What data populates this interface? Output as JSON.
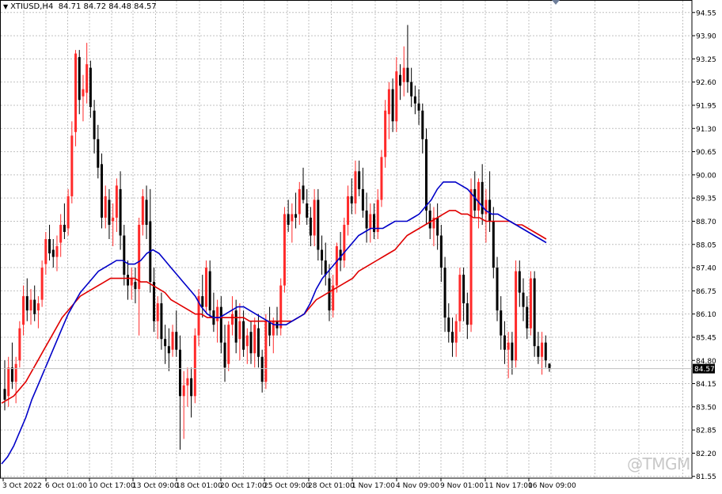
{
  "window": {
    "symbol_label": "XTIUSD,H4",
    "ohlc_label": "84.71 84.72 84.48 84.57",
    "watermark": "@TMGM"
  },
  "colors": {
    "bull": "#ff2a2a",
    "bear": "#000000",
    "ma_fast": "#0000c8",
    "ma_slow": "#e00000",
    "grid": "#c0c0c0",
    "price_line": "#c0c0c0"
  },
  "chart_data": {
    "type": "candlestick",
    "symbol": "XTIUSD",
    "timeframe": "H4",
    "ylim": [
      81.5,
      94.9
    ],
    "y_ticks": [
      "94.55",
      "93.90",
      "93.25",
      "92.60",
      "91.95",
      "91.30",
      "90.65",
      "90.00",
      "89.35",
      "88.70",
      "88.05",
      "87.40",
      "86.75",
      "86.10",
      "85.45",
      "84.80",
      "84.15",
      "83.50",
      "82.85",
      "82.20",
      "81.55"
    ],
    "x_ticks": [
      "3 Oct 2022",
      "6 Oct 01:00",
      "10 Oct 17:00",
      "13 Oct 09:00",
      "18 Oct 01:00",
      "20 Oct 17:00",
      "25 Oct 09:00",
      "28 Oct 01:00",
      "1 Nov 17:00",
      "4 Nov 09:00",
      "9 Nov 01:00",
      "11 Nov 17:00",
      "16 Nov 09:00"
    ],
    "current_price": "84.57",
    "ohlc": [
      [
        84.0,
        84.8,
        83.4,
        83.7
      ],
      [
        83.8,
        84.9,
        83.5,
        84.6
      ],
      [
        84.6,
        85.3,
        84.0,
        84.2
      ],
      [
        84.2,
        84.9,
        83.6,
        84.7
      ],
      [
        84.8,
        85.9,
        84.6,
        85.7
      ],
      [
        85.8,
        86.9,
        85.5,
        86.6
      ],
      [
        86.6,
        87.1,
        85.9,
        86.2
      ],
      [
        86.2,
        86.8,
        85.8,
        86.5
      ],
      [
        86.5,
        86.9,
        85.9,
        86.1
      ],
      [
        86.2,
        86.6,
        85.7,
        86.4
      ],
      [
        86.5,
        87.6,
        86.3,
        87.4
      ],
      [
        87.5,
        88.4,
        87.2,
        88.2
      ],
      [
        88.2,
        88.6,
        87.6,
        87.8
      ],
      [
        87.9,
        88.2,
        87.4,
        87.7
      ],
      [
        87.7,
        88.3,
        87.3,
        88.0
      ],
      [
        88.1,
        88.9,
        87.7,
        88.6
      ],
      [
        88.6,
        89.2,
        88.2,
        88.4
      ],
      [
        88.5,
        89.6,
        88.3,
        89.4
      ],
      [
        89.4,
        91.5,
        89.2,
        91.1
      ],
      [
        91.2,
        93.5,
        90.8,
        93.4
      ],
      [
        93.3,
        93.5,
        91.7,
        92.1
      ],
      [
        92.2,
        92.8,
        91.5,
        92.4
      ],
      [
        92.3,
        93.7,
        92.0,
        93.1
      ],
      [
        93.0,
        93.2,
        91.6,
        91.9
      ],
      [
        91.8,
        92.1,
        90.6,
        91.0
      ],
      [
        91.0,
        91.4,
        89.9,
        90.2
      ],
      [
        90.3,
        90.6,
        88.5,
        88.8
      ],
      [
        88.8,
        89.7,
        88.5,
        89.4
      ],
      [
        89.3,
        89.6,
        88.2,
        88.6
      ],
      [
        88.7,
        89.2,
        88.0,
        88.8
      ],
      [
        88.8,
        89.9,
        88.4,
        89.7
      ],
      [
        89.6,
        90.1,
        87.9,
        88.3
      ],
      [
        88.3,
        88.6,
        86.9,
        87.2
      ],
      [
        87.2,
        87.6,
        86.5,
        86.9
      ],
      [
        86.9,
        87.4,
        86.5,
        87.1
      ],
      [
        87.0,
        87.4,
        86.4,
        86.8
      ],
      [
        86.8,
        88.8,
        85.5,
        88.6
      ],
      [
        88.6,
        89.6,
        88.3,
        89.4
      ],
      [
        89.3,
        89.7,
        88.2,
        88.6
      ],
      [
        88.7,
        89.6,
        86.7,
        87.0
      ],
      [
        87.0,
        87.4,
        85.6,
        85.9
      ],
      [
        85.9,
        86.6,
        85.4,
        86.4
      ],
      [
        86.4,
        86.7,
        85.1,
        85.4
      ],
      [
        85.4,
        85.8,
        84.7,
        85.2
      ],
      [
        85.2,
        85.7,
        84.5,
        85.0
      ],
      [
        85.1,
        85.8,
        84.9,
        85.6
      ],
      [
        85.6,
        86.2,
        84.9,
        85.1
      ],
      [
        85.1,
        85.5,
        82.3,
        83.8
      ],
      [
        83.8,
        84.5,
        82.6,
        84.1
      ],
      [
        84.1,
        84.6,
        83.5,
        84.3
      ],
      [
        84.3,
        84.6,
        83.2,
        83.8
      ],
      [
        83.8,
        85.7,
        83.6,
        85.5
      ],
      [
        85.5,
        86.8,
        85.2,
        86.6
      ],
      [
        86.6,
        87.2,
        86.0,
        86.3
      ],
      [
        86.3,
        87.6,
        86.1,
        87.4
      ],
      [
        87.3,
        87.6,
        86.0,
        86.2
      ],
      [
        86.2,
        86.7,
        85.6,
        85.8
      ],
      [
        85.9,
        86.5,
        85.3,
        86.3
      ],
      [
        86.3,
        86.6,
        85.0,
        85.3
      ],
      [
        85.3,
        85.8,
        84.2,
        84.6
      ],
      [
        84.7,
        85.9,
        84.5,
        85.8
      ],
      [
        85.8,
        86.6,
        85.5,
        86.1
      ],
      [
        86.2,
        86.5,
        85.0,
        85.3
      ],
      [
        85.4,
        86.4,
        84.8,
        85.9
      ],
      [
        85.9,
        86.2,
        84.9,
        85.1
      ],
      [
        85.2,
        85.7,
        84.7,
        85.5
      ],
      [
        85.6,
        85.9,
        84.7,
        85.0
      ],
      [
        85.0,
        86.0,
        84.6,
        85.8
      ],
      [
        85.7,
        86.1,
        84.6,
        84.9
      ],
      [
        84.9,
        85.1,
        83.9,
        84.2
      ],
      [
        84.2,
        86.1,
        84.0,
        85.9
      ],
      [
        85.9,
        86.3,
        85.2,
        85.5
      ],
      [
        85.5,
        86.0,
        85.0,
        85.9
      ],
      [
        85.9,
        86.3,
        85.5,
        85.7
      ],
      [
        85.7,
        87.1,
        85.5,
        86.9
      ],
      [
        86.9,
        89.1,
        86.7,
        88.9
      ],
      [
        88.9,
        89.3,
        88.4,
        88.6
      ],
      [
        88.7,
        89.2,
        88.1,
        88.9
      ],
      [
        88.9,
        89.5,
        88.5,
        88.8
      ],
      [
        88.9,
        89.8,
        88.6,
        89.6
      ],
      [
        89.7,
        90.2,
        89.2,
        89.3
      ],
      [
        89.2,
        89.6,
        88.6,
        88.8
      ],
      [
        88.8,
        89.1,
        88.0,
        88.3
      ],
      [
        88.3,
        89.6,
        88.0,
        89.3
      ],
      [
        89.3,
        89.6,
        87.6,
        87.9
      ],
      [
        87.9,
        88.3,
        87.2,
        87.6
      ],
      [
        87.6,
        88.1,
        86.9,
        87.2
      ],
      [
        87.1,
        87.5,
        85.9,
        86.2
      ],
      [
        86.2,
        87.2,
        86.0,
        86.9
      ],
      [
        86.9,
        88.1,
        86.7,
        88.0
      ],
      [
        87.9,
        88.4,
        87.3,
        87.6
      ],
      [
        87.6,
        88.8,
        87.4,
        88.6
      ],
      [
        88.6,
        89.7,
        88.3,
        89.4
      ],
      [
        89.4,
        89.9,
        88.9,
        89.2
      ],
      [
        89.2,
        90.4,
        88.9,
        90.1
      ],
      [
        90.1,
        90.4,
        89.4,
        89.6
      ],
      [
        89.6,
        90.2,
        88.8,
        89.0
      ],
      [
        89.0,
        89.5,
        88.1,
        88.5
      ],
      [
        88.5,
        89.2,
        88.1,
        88.9
      ],
      [
        88.9,
        89.2,
        88.2,
        88.4
      ],
      [
        88.4,
        89.6,
        88.2,
        89.3
      ],
      [
        89.3,
        90.7,
        89.1,
        90.5
      ],
      [
        90.5,
        92.1,
        90.2,
        91.8
      ],
      [
        91.7,
        92.6,
        91.0,
        92.4
      ],
      [
        92.4,
        92.7,
        91.2,
        91.5
      ],
      [
        91.5,
        93.3,
        91.2,
        92.9
      ],
      [
        92.8,
        93.1,
        92.1,
        92.5
      ],
      [
        92.6,
        93.6,
        92.2,
        93.0
      ],
      [
        93.0,
        94.2,
        92.3,
        92.6
      ],
      [
        92.6,
        93.0,
        91.9,
        92.2
      ],
      [
        92.2,
        92.5,
        91.7,
        92.0
      ],
      [
        92.0,
        92.4,
        91.4,
        91.8
      ],
      [
        91.8,
        92.0,
        90.6,
        91.0
      ],
      [
        91.0,
        91.3,
        88.6,
        89.0
      ],
      [
        89.0,
        89.2,
        88.2,
        88.5
      ],
      [
        88.5,
        89.1,
        88.0,
        88.8
      ],
      [
        88.8,
        89.2,
        87.9,
        88.3
      ],
      [
        88.3,
        88.6,
        87.0,
        87.4
      ],
      [
        87.4,
        87.7,
        85.6,
        86.0
      ],
      [
        86.0,
        86.4,
        85.3,
        85.6
      ],
      [
        85.6,
        86.0,
        84.9,
        85.3
      ],
      [
        85.3,
        86.1,
        84.9,
        85.9
      ],
      [
        85.9,
        87.4,
        85.6,
        87.2
      ],
      [
        87.2,
        87.4,
        85.9,
        86.4
      ],
      [
        86.4,
        86.7,
        85.4,
        85.8
      ],
      [
        85.8,
        89.9,
        85.6,
        89.6
      ],
      [
        89.6,
        90.1,
        88.8,
        89.0
      ],
      [
        89.0,
        89.9,
        88.5,
        89.8
      ],
      [
        89.8,
        90.3,
        88.6,
        88.9
      ],
      [
        88.9,
        89.6,
        88.1,
        89.3
      ],
      [
        89.3,
        90.1,
        88.4,
        88.7
      ],
      [
        88.7,
        89.1,
        87.1,
        87.4
      ],
      [
        87.4,
        87.7,
        85.9,
        86.2
      ],
      [
        86.2,
        86.6,
        85.1,
        85.5
      ],
      [
        85.5,
        85.9,
        84.7,
        85.1
      ],
      [
        85.1,
        85.6,
        84.3,
        85.3
      ],
      [
        85.3,
        85.6,
        84.4,
        84.8
      ],
      [
        84.8,
        87.6,
        84.6,
        87.3
      ],
      [
        87.3,
        87.6,
        86.3,
        86.7
      ],
      [
        86.7,
        87.1,
        85.9,
        86.3
      ],
      [
        86.3,
        86.6,
        85.4,
        85.7
      ],
      [
        85.7,
        87.3,
        85.5,
        87.1
      ],
      [
        87.1,
        87.3,
        84.9,
        85.2
      ],
      [
        85.2,
        85.6,
        84.7,
        84.9
      ],
      [
        84.9,
        85.6,
        84.4,
        85.3
      ],
      [
        85.3,
        85.5,
        84.6,
        84.8
      ],
      [
        84.71,
        84.72,
        84.48,
        84.57
      ]
    ],
    "ma_fast": [
      81.9,
      82.1,
      82.4,
      82.8,
      83.2,
      83.7,
      84.1,
      84.5,
      84.9,
      85.3,
      85.7,
      86.1,
      86.4,
      86.7,
      86.9,
      87.1,
      87.3,
      87.4,
      87.5,
      87.6,
      87.6,
      87.5,
      87.5,
      87.6,
      87.8,
      87.9,
      87.8,
      87.6,
      87.4,
      87.2,
      87.0,
      86.8,
      86.6,
      86.3,
      86.1,
      86.0,
      86.0,
      86.1,
      86.2,
      86.3,
      86.3,
      86.2,
      86.1,
      86.0,
      85.9,
      85.8,
      85.8,
      85.8,
      85.9,
      86.0,
      86.1,
      86.4,
      86.8,
      87.1,
      87.3,
      87.5,
      87.7,
      87.9,
      88.1,
      88.3,
      88.4,
      88.5,
      88.5,
      88.5,
      88.6,
      88.7,
      88.7,
      88.7,
      88.8,
      88.9,
      89.1,
      89.3,
      89.6,
      89.8,
      89.8,
      89.8,
      89.7,
      89.6,
      89.4,
      89.2,
      89.0,
      88.9,
      88.9,
      88.8,
      88.7,
      88.6,
      88.5,
      88.4,
      88.3,
      88.2,
      88.1
    ],
    "ma_slow": [
      83.6,
      83.7,
      83.8,
      84.0,
      84.2,
      84.5,
      84.8,
      85.1,
      85.4,
      85.7,
      86.0,
      86.2,
      86.4,
      86.6,
      86.7,
      86.8,
      86.9,
      87.0,
      87.1,
      87.1,
      87.1,
      87.1,
      87.1,
      87.0,
      87.0,
      86.9,
      86.8,
      86.7,
      86.5,
      86.4,
      86.3,
      86.2,
      86.1,
      86.1,
      86.0,
      86.0,
      86.0,
      86.0,
      86.0,
      86.0,
      86.0,
      85.9,
      85.9,
      85.9,
      85.9,
      85.9,
      85.9,
      85.9,
      85.9,
      86.0,
      86.1,
      86.3,
      86.5,
      86.6,
      86.7,
      86.8,
      86.9,
      87.0,
      87.1,
      87.3,
      87.4,
      87.5,
      87.6,
      87.7,
      87.8,
      87.9,
      88.1,
      88.3,
      88.4,
      88.5,
      88.6,
      88.7,
      88.8,
      88.9,
      89.0,
      89.0,
      88.9,
      88.9,
      88.8,
      88.8,
      88.7,
      88.7,
      88.7,
      88.7,
      88.7,
      88.6,
      88.6,
      88.5,
      88.4,
      88.3,
      88.2
    ]
  }
}
